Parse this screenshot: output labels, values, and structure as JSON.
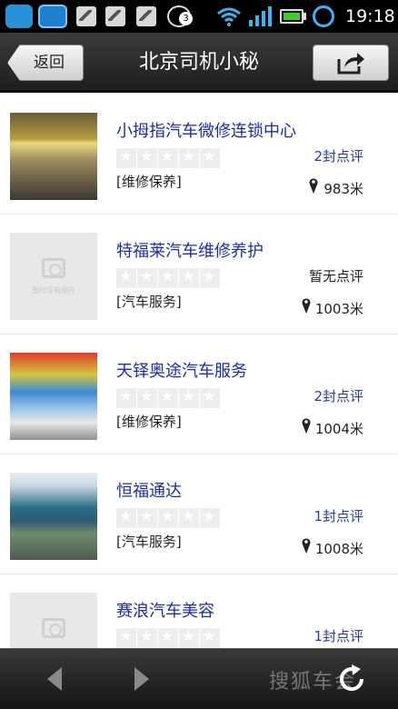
{
  "status_bar": {
    "time": "19:18",
    "notification_count": "3",
    "icons": [
      "app-icon",
      "app-icon",
      "image-icon",
      "image-icon",
      "image-icon",
      "chat-icon",
      "wifi-icon",
      "signal-icon",
      "battery-icon",
      "alarm-icon"
    ]
  },
  "header": {
    "back_label": "返回",
    "title": "北京司机小秘",
    "share_icon": "share-icon"
  },
  "colors": {
    "title_bar": "#2b2b2b",
    "link_blue": "#1c2ea6",
    "review_blue": "#2a3c9c"
  },
  "listings": [
    {
      "name": "小拇指汽车微修连锁中心",
      "rating": 0,
      "category": "[维修保养]",
      "reviews": "2封点评",
      "distance": "983米",
      "thumbnail": "photo"
    },
    {
      "name": "特福莱汽车维修养护",
      "rating": 0,
      "category": "[汽车服务]",
      "reviews": "暂无点评",
      "distance": "1003米",
      "thumbnail": "placeholder",
      "placeholder_text": "暂时没有图片"
    },
    {
      "name": "天铎奥途汽车服务",
      "rating": 0,
      "category": "[维修保养]",
      "reviews": "2封点评",
      "distance": "1004米",
      "thumbnail": "photo"
    },
    {
      "name": "恒福通达",
      "rating": 0,
      "category": "[汽车服务]",
      "reviews": "1封点评",
      "distance": "1008米",
      "thumbnail": "photo"
    },
    {
      "name": "赛浪汽车美容",
      "rating": 0,
      "category": "",
      "reviews": "1封点评",
      "distance": "",
      "thumbnail": "placeholder"
    }
  ],
  "bottom_bar": {
    "watermark": "搜狐车会",
    "icons": [
      "prev-arrow-icon",
      "next-arrow-icon",
      "refresh-icon"
    ]
  }
}
